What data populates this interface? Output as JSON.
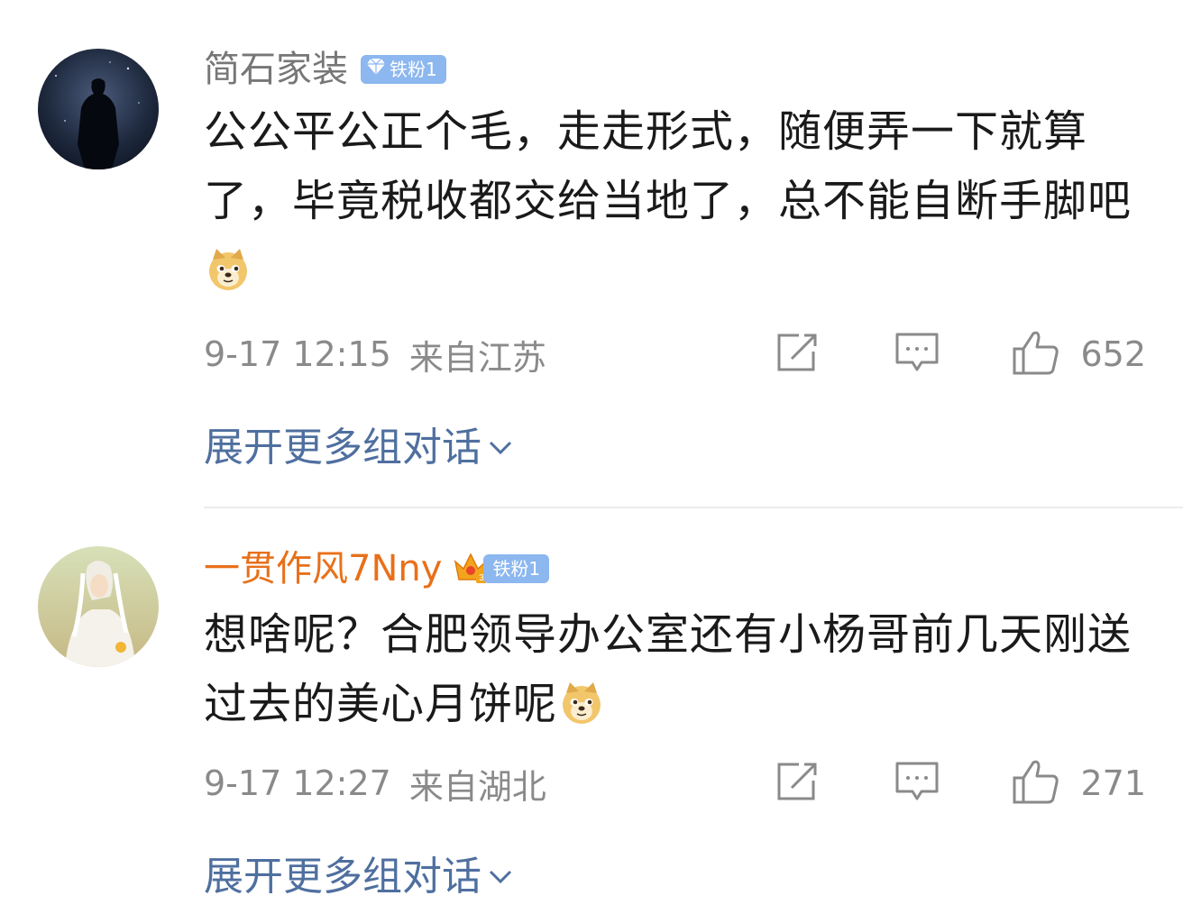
{
  "comments": [
    {
      "username": "简石家装",
      "badge": "铁粉1",
      "text": "公公平公正个毛，走走形式，随便弄一下就算了，毕竟税收都交给当地了，总不能自断手脚吧",
      "time": "9-17 12:15",
      "location": "来自江苏",
      "likes": "652",
      "expand": "展开更多组对话"
    },
    {
      "username": "一贯作风7Nny",
      "badge": "铁粉1",
      "text": "想啥呢？合肥领导办公室还有小杨哥前几天刚送过去的美心月饼呢",
      "time": "9-17 12:27",
      "location": "来自湖北",
      "likes": "271",
      "expand": "展开更多组对话"
    }
  ],
  "colors": {
    "username_default": "#777777",
    "username_vip": "#e8701a",
    "badge_bg": "#8cb7ef",
    "expand_link": "#4f6f9f",
    "meta_text": "#8a8a8a"
  },
  "icons": [
    "diamond-icon",
    "crown-icon",
    "doge-emoji",
    "share-icon",
    "comment-icon",
    "like-icon",
    "chevron-down-icon"
  ]
}
